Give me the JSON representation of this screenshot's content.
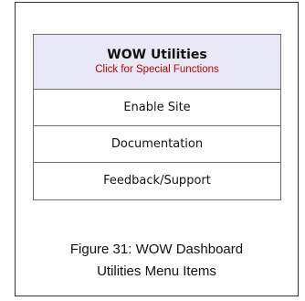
{
  "menu": {
    "title": "WOW Utilities",
    "subtitle": "Click for Special Functions",
    "items": [
      {
        "label": "Enable Site"
      },
      {
        "label": "Documentation"
      },
      {
        "label": "Feedback/Support"
      }
    ]
  },
  "caption": {
    "line1": "Figure 31: WOW Dashboard",
    "line2": "Utilities Menu Items"
  },
  "colors": {
    "header_background": "#e8e8f6",
    "subtitle_text": "#c00000",
    "border": "#6d6d6d"
  }
}
